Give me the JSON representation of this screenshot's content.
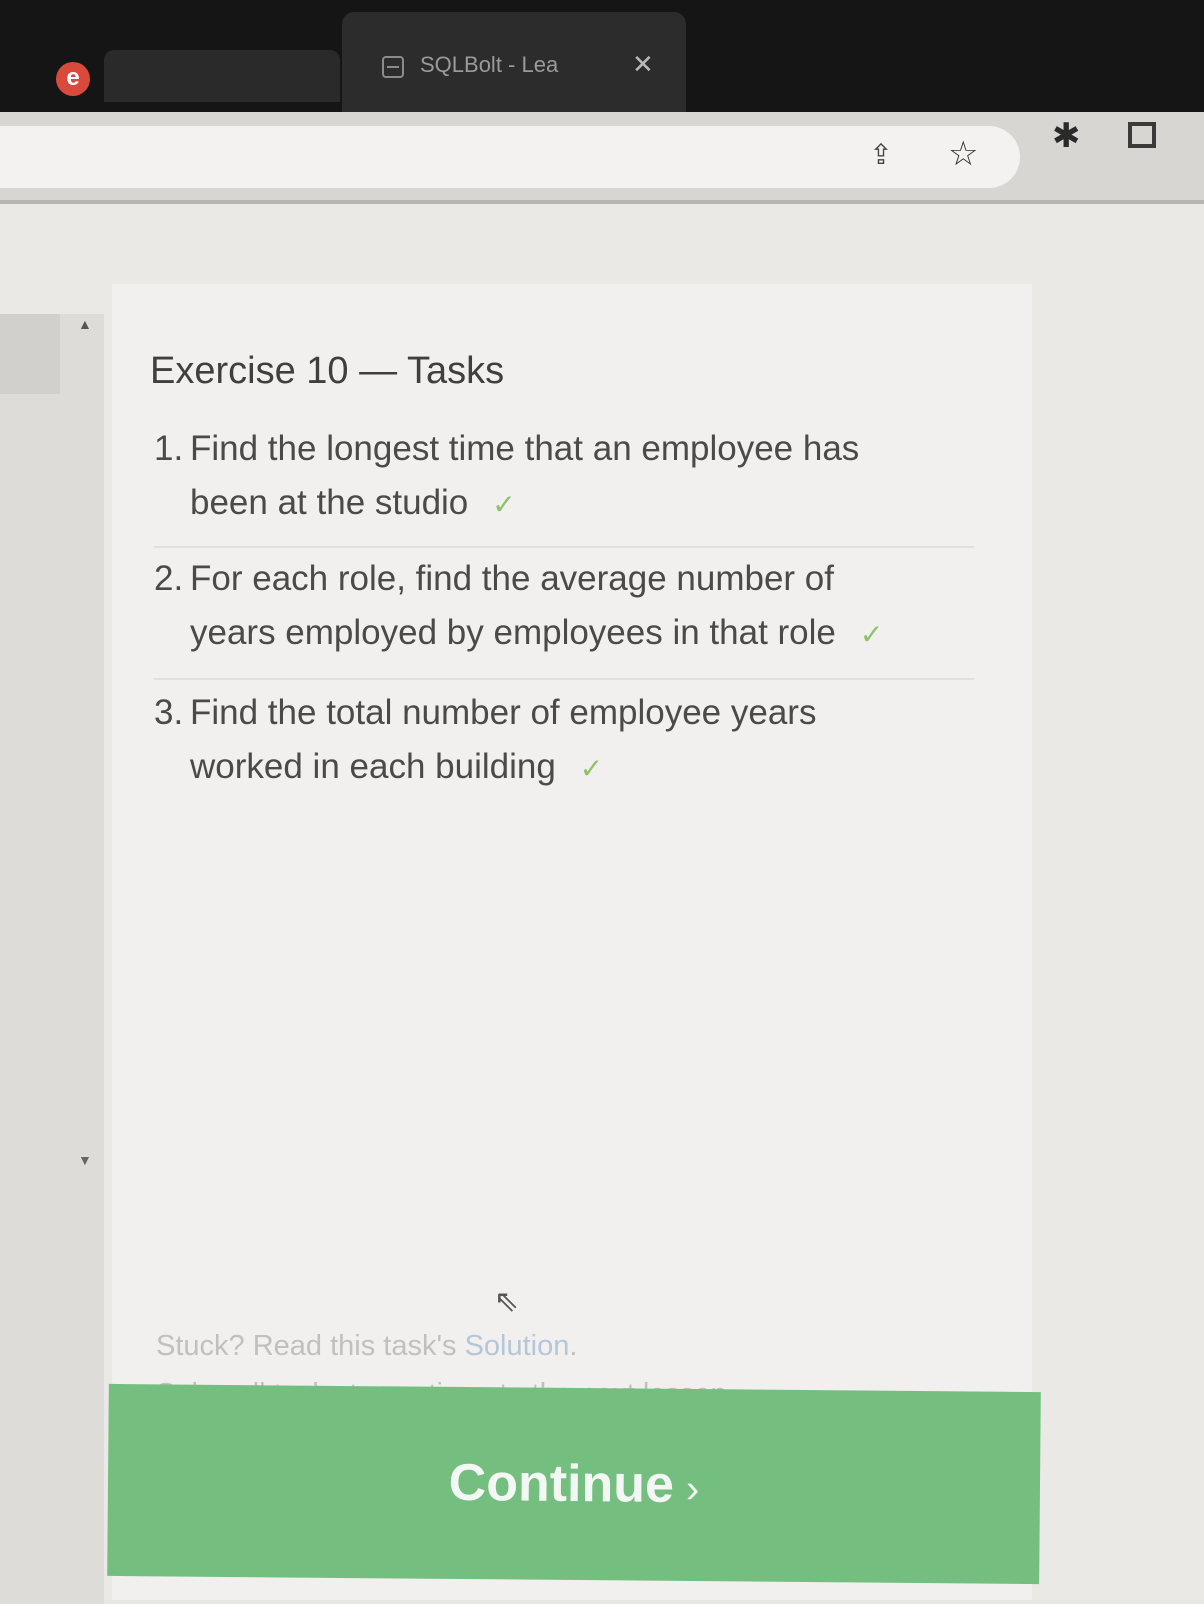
{
  "browser": {
    "tab_title": "SQLBolt - Lea",
    "tab_close": "✕",
    "logo_glyph": "e",
    "icons": [
      "browser-logo-icon",
      "database-icon",
      "share-icon",
      "star-icon",
      "extensions-puzzle-icon",
      "window-icon"
    ]
  },
  "exercise": {
    "title": "Exercise 10 — Tasks",
    "tasks": [
      {
        "number": "1.",
        "line1": "Find the longest time that an employee has",
        "line2": "been at the studio",
        "completed": true
      },
      {
        "number": "2.",
        "line1": "For each role, find the average number of",
        "line2": "years employed by employees in that role",
        "completed": true
      },
      {
        "number": "3.",
        "line1": "Find the total number of employee years",
        "line2": "worked in each building",
        "completed": true
      }
    ],
    "check_mark": "✓",
    "stuck_prefix": "Stuck? Read this task's ",
    "solution_link": "Solution",
    "stuck_suffix": ".",
    "solve_all_text": "Solve all tasks to continue to the next lesson.",
    "continue_label": "Continue",
    "continue_chevron": "›"
  },
  "colors": {
    "check": "#8cc36a",
    "continue_bg": "#74bf7f",
    "tab_bar": "#151515"
  }
}
